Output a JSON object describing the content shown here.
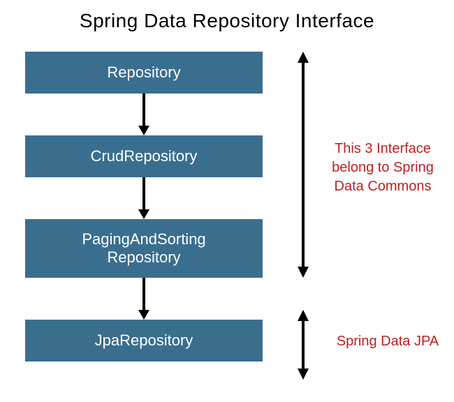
{
  "title": "Spring Data Repository Interface",
  "boxes": {
    "b1": "Repository",
    "b2": "CrudRepository",
    "b3": "PagingAndSorting\nRepository",
    "b4": "JpaRepository"
  },
  "annotations": {
    "a1": "This 3 Interface belong to Spring Data Commons",
    "a2": "Spring Data JPA"
  },
  "colors": {
    "box_fill": "#3a6e8f",
    "box_text": "#ffffff",
    "annotation": "#c02020",
    "arrow": "#000000"
  }
}
